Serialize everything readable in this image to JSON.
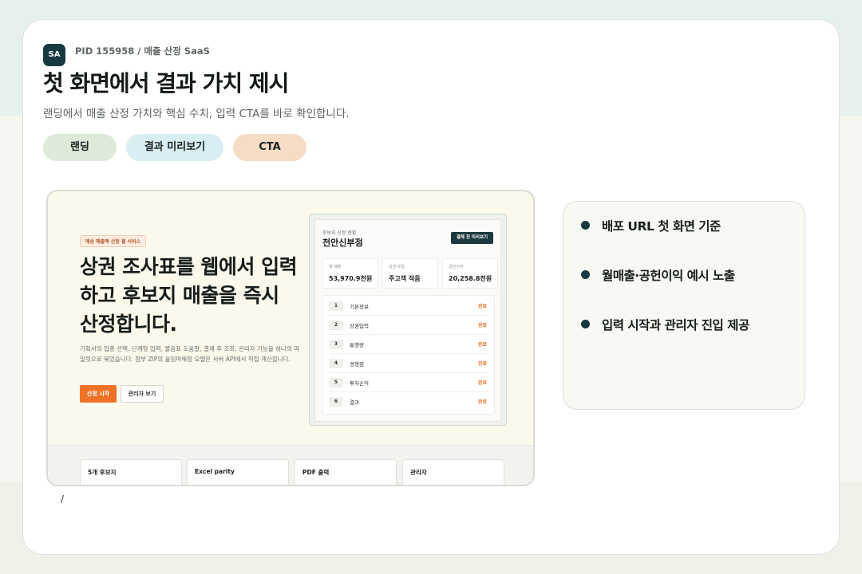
{
  "header": {
    "logo_text": "SA",
    "pid_line": "PID 155958 / 매출 산정 SaaS",
    "title": "첫 화면에서 결과 가치 제시",
    "subtitle": "랜딩에서 매출 산정 가치와 핵심 수치, 입력 CTA를 바로 확인합니다."
  },
  "tags": [
    "랜딩",
    "결과 미리보기",
    "CTA"
  ],
  "preview": {
    "badge": "예상 매출액 산정 웹 서비스",
    "heading": "상권 조사표를 웹에서 입력하고 후보지 매출을 즉시 산정합니다.",
    "description": "기획서의 업종 선택, 단계형 입력, 물음표 도움말, 결제 후 조회, 관리자 기능을 하나의 파일럿으로 묶었습니다. 첨부 ZIP의 올임마해장 모델은 서버 API에서 직접 계산합니다.",
    "start_button": "산정 시작",
    "admin_button": "관리자 보기",
    "panel": {
      "label": "후보지 산정 현황",
      "store_name": "천안신부점",
      "preview_button": "결제 전 미리보기",
      "stats": [
        {
          "label": "월 매출",
          "value": "53,970.9천원"
        },
        {
          "label": "상권 유형",
          "value": "주고객 적음"
        },
        {
          "label": "공헌이익",
          "value": "20,258.8천원"
        }
      ],
      "steps": [
        {
          "num": "1",
          "name": "기본정보",
          "status": "완료"
        },
        {
          "num": "2",
          "name": "상권입력",
          "status": "완료"
        },
        {
          "num": "3",
          "name": "통행량",
          "status": "완료"
        },
        {
          "num": "4",
          "name": "경쟁점",
          "status": "완료"
        },
        {
          "num": "5",
          "name": "투자손익",
          "status": "완료"
        },
        {
          "num": "6",
          "name": "결과",
          "status": "완료"
        }
      ]
    },
    "features": [
      "5개 후보지",
      "Excel parity",
      "PDF 출력",
      "관리자"
    ]
  },
  "footer_mark": "/",
  "bullets": [
    "배포 URL 첫 화면 기준",
    "월매출·공헌이익 예시 노출",
    "입력 시작과 관리자 진입 제공"
  ],
  "colors": {
    "accent_dark": "#163a3d",
    "accent_orange": "#f07227",
    "tag_green": "#dde9d9",
    "tag_blue": "#d9eef2",
    "tag_orange": "#f6dcc4"
  }
}
